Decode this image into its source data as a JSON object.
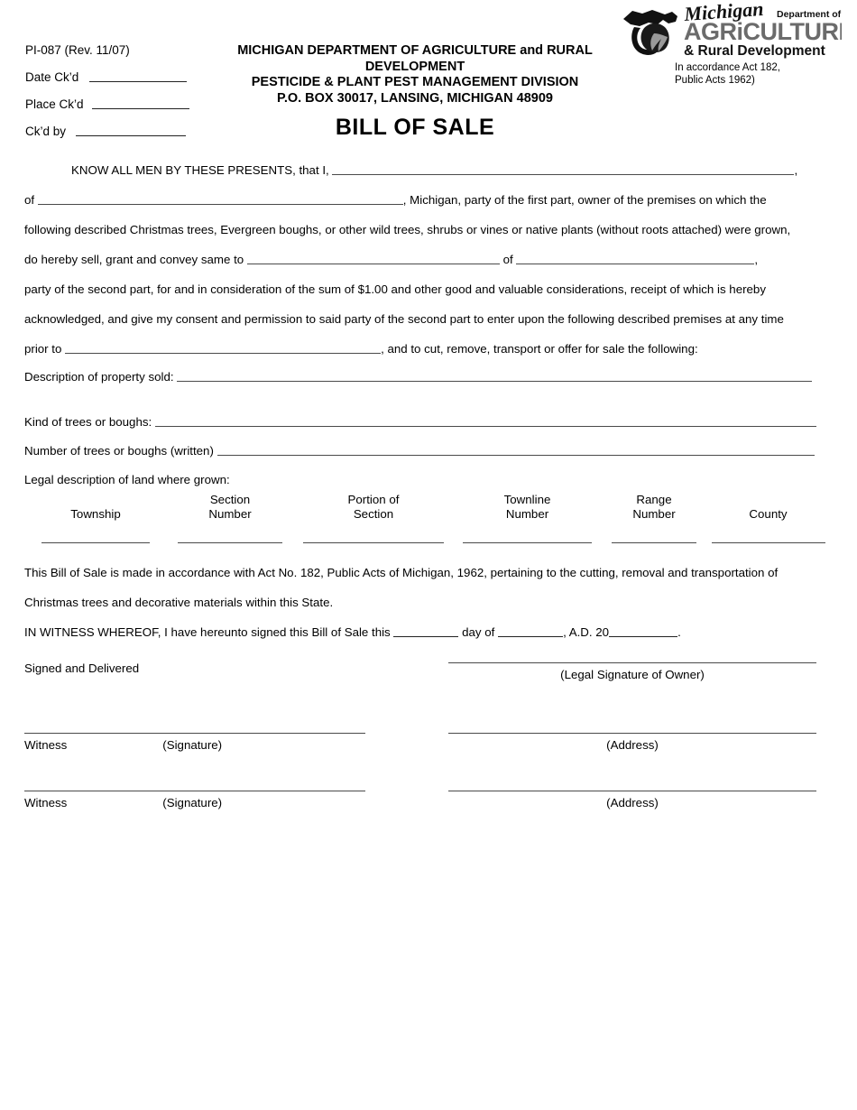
{
  "document": {
    "form_number": "PI-087 (Rev. 11/07)",
    "title": "BILL OF SALE"
  },
  "header": {
    "left_fields": [
      {
        "label": "Date Ck’d"
      },
      {
        "label": "Place Ck’d"
      },
      {
        "label": "Ck’d by"
      }
    ],
    "agency_lines": [
      "MICHIGAN DEPARTMENT OF AGRICULTURE and RURAL DEVELOPMENT",
      "PESTICIDE & PLANT PEST MANAGEMENT DIVISION",
      "P.O. BOX 30017, LANSING, MICHIGAN  48909"
    ]
  },
  "logo": {
    "script_word": "Michigan",
    "dept_of": "Department of",
    "agriculture": "AGRiCULTURE",
    "rural": "& Rural Development",
    "note_line_1": "In accordance Act 182,",
    "note_line_2": "Public Acts 1962)"
  },
  "body": {
    "p1_lead": "KNOW ALL MEN BY THESE PRESENTS,  that I,",
    "p1_tail": ",",
    "p2_lead": "of",
    "p2_tail": ", Michigan, party of the first part, owner of the premises on which the",
    "p3": "following described Christmas trees, Evergreen boughs, or other wild trees, shrubs or vines or native plants (without roots attached) were grown,",
    "p4_lead": "do hereby sell, grant and convey same to",
    "p4_mid": "of",
    "p4_tail": ",",
    "p5": "party of the second part, for and in consideration of the sum of $1.00 and other good and valuable considerations, receipt of which is hereby",
    "p6": "acknowledged, and give my consent and permission to said party of the second part to enter upon the following described premises at any time",
    "p7_lead": "prior to",
    "p7_tail": ", and to cut, remove, transport or offer for sale the following:",
    "p8_lead": "Description of property sold:",
    "p9_lead": "Kind of trees or boughs:",
    "p10_lead": "Number of trees or boughs (written)",
    "p11": "Legal description of land where grown:"
  },
  "legal_table": {
    "columns": [
      {
        "line1": "",
        "line2": "Township"
      },
      {
        "line1": "Section",
        "line2": "Number"
      },
      {
        "line1": "Portion of",
        "line2": "Section"
      },
      {
        "line1": "Townline",
        "line2": "Number"
      },
      {
        "line1": "Range",
        "line2": "Number"
      },
      {
        "line1": "",
        "line2": "County"
      }
    ]
  },
  "closing": {
    "act_line_1": "This Bill of Sale is made in accordance with Act No. 182, Public Acts of Michigan, 1962, pertaining to the cutting, removal and transportation of",
    "act_line_2": "Christmas trees and decorative materials within this State.",
    "witness_lead": "IN WITNESS WHEREOF, I have hereunto signed this Bill of Sale this",
    "witness_day_of": "day of",
    "witness_ad": ", A.D. 20",
    "witness_end": "."
  },
  "signatures": {
    "signed_and_delivered": "Signed and Delivered",
    "legal_signature_caption": "(Legal Signature of Owner)",
    "witness_label": "Witness",
    "signature_caption": "(Signature)",
    "address_caption": "(Address)"
  }
}
